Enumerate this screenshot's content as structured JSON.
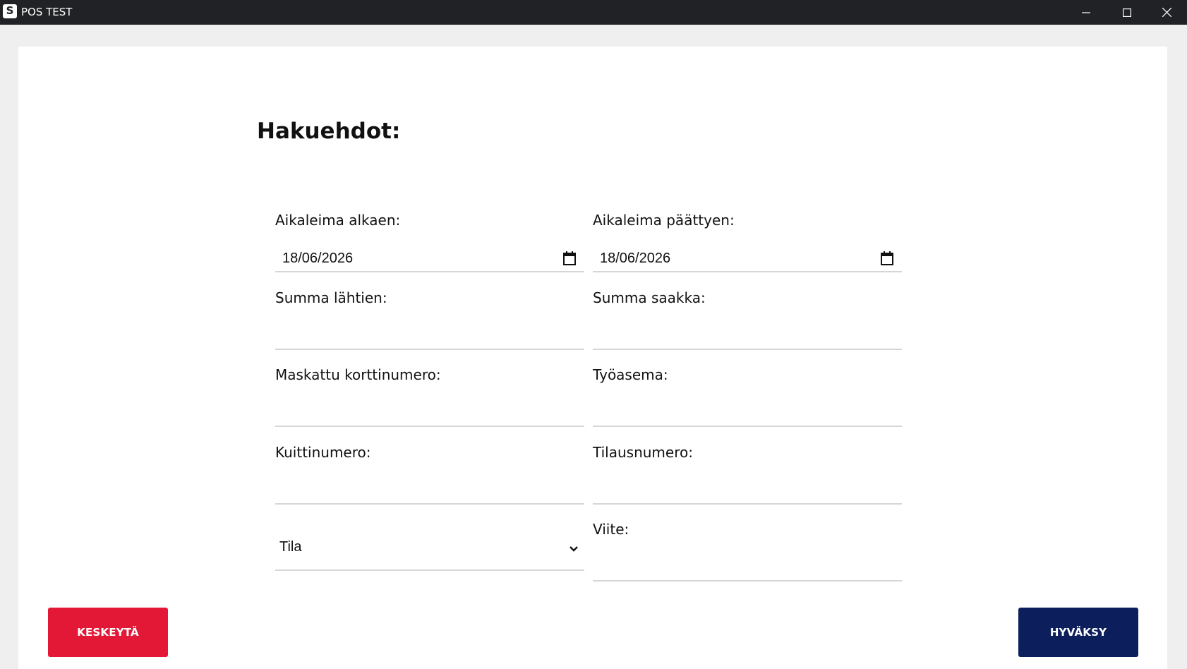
{
  "window": {
    "title": "POS TEST",
    "icon_letter": "S"
  },
  "form": {
    "title": "Hakuehdot:",
    "fields": {
      "date_start": {
        "label": "Aikaleima alkaen:",
        "value": "18/06/2026"
      },
      "date_end": {
        "label": "Aikaleima päättyen:",
        "value": "18/06/2026"
      },
      "sum_from": {
        "label": "Summa lähtien:",
        "value": ""
      },
      "sum_to": {
        "label": "Summa saakka:",
        "value": ""
      },
      "masked_card": {
        "label": "Maskattu korttinumero:",
        "value": ""
      },
      "workstation": {
        "label": "Työasema:",
        "value": ""
      },
      "receipt_number": {
        "label": "Kuittinumero:",
        "value": ""
      },
      "order_number": {
        "label": "Tilausnumero:",
        "value": ""
      },
      "status": {
        "selected": "Tila"
      },
      "reference": {
        "label": "Viite:",
        "value": ""
      }
    }
  },
  "buttons": {
    "cancel": "KESKEYTÄ",
    "accept": "HYVÄKSY"
  },
  "colors": {
    "titlebar": "#202225",
    "cancel": "#e31837",
    "accept": "#0c1f5c"
  },
  "icons": {
    "app": "app-logo-icon",
    "minimize": "minimize-icon",
    "maximize": "maximize-icon",
    "close": "close-icon",
    "calendar": "calendar-icon",
    "dropdown": "chevron-down-icon"
  }
}
